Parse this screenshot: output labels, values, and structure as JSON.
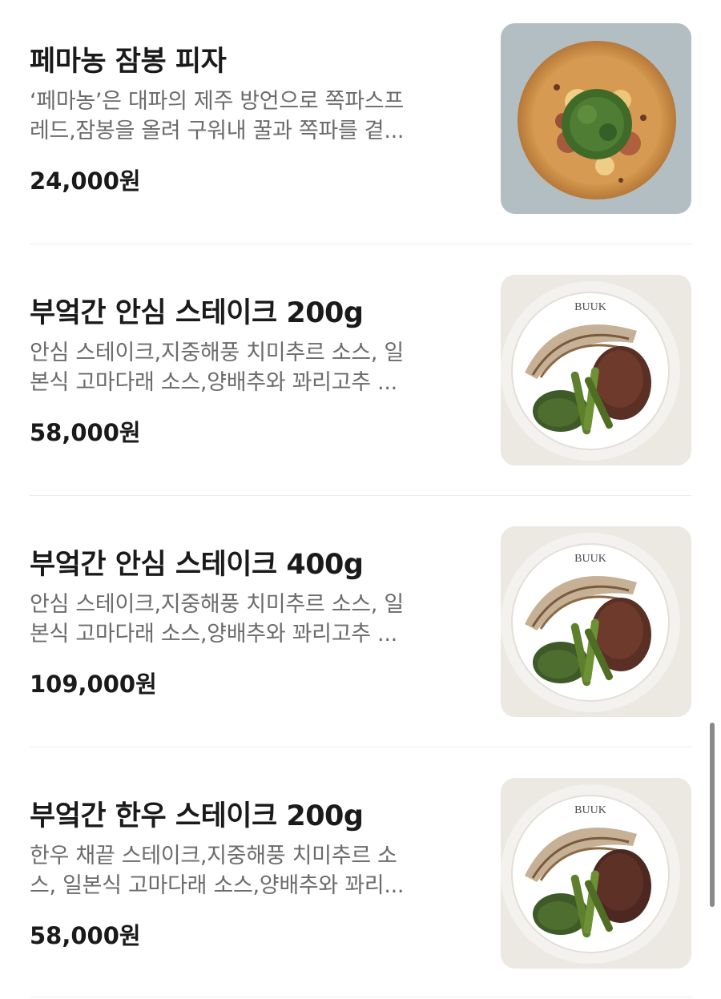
{
  "menu": {
    "items": [
      {
        "name": "페마농 잠봉 피자",
        "desc_line1": "‘페마농’은 대파의 제주 방언으로 쪽파스프",
        "desc_line2": "레드,잠봉을 올려 구워내 꿀과 쪽파를 곁...",
        "price": "24,000원",
        "image": "pizza-photo"
      },
      {
        "name": "부엌간 안심 스테이크 200g",
        "desc_line1": "안심 스테이크,지중해풍 치미추르 소스, 일",
        "desc_line2": "본식 고마다래 소스,양배추와 꽈리고추 ...",
        "price": "58,000원",
        "image": "steak-photo",
        "plate_text": "BUUK"
      },
      {
        "name": "부엌간 안심 스테이크 400g",
        "desc_line1": "안심 스테이크,지중해풍 치미추르 소스, 일",
        "desc_line2": "본식 고마다래 소스,양배추와 꽈리고추 ...",
        "price": "109,000원",
        "image": "steak-photo",
        "plate_text": "BUUK"
      },
      {
        "name": "부엌간 한우 스테이크 200g",
        "desc_line1": "한우 채끝 스테이크,지중해풍 치미추르 소",
        "desc_line2": "스, 일본식 고마다래 소스,양배추와 꽈리...",
        "price": "58,000원",
        "image": "steak-photo",
        "plate_text": "BUUK"
      }
    ]
  },
  "colors": {
    "title": "#1a1a1a",
    "description": "#6b6b6b",
    "divider": "#ececec"
  }
}
